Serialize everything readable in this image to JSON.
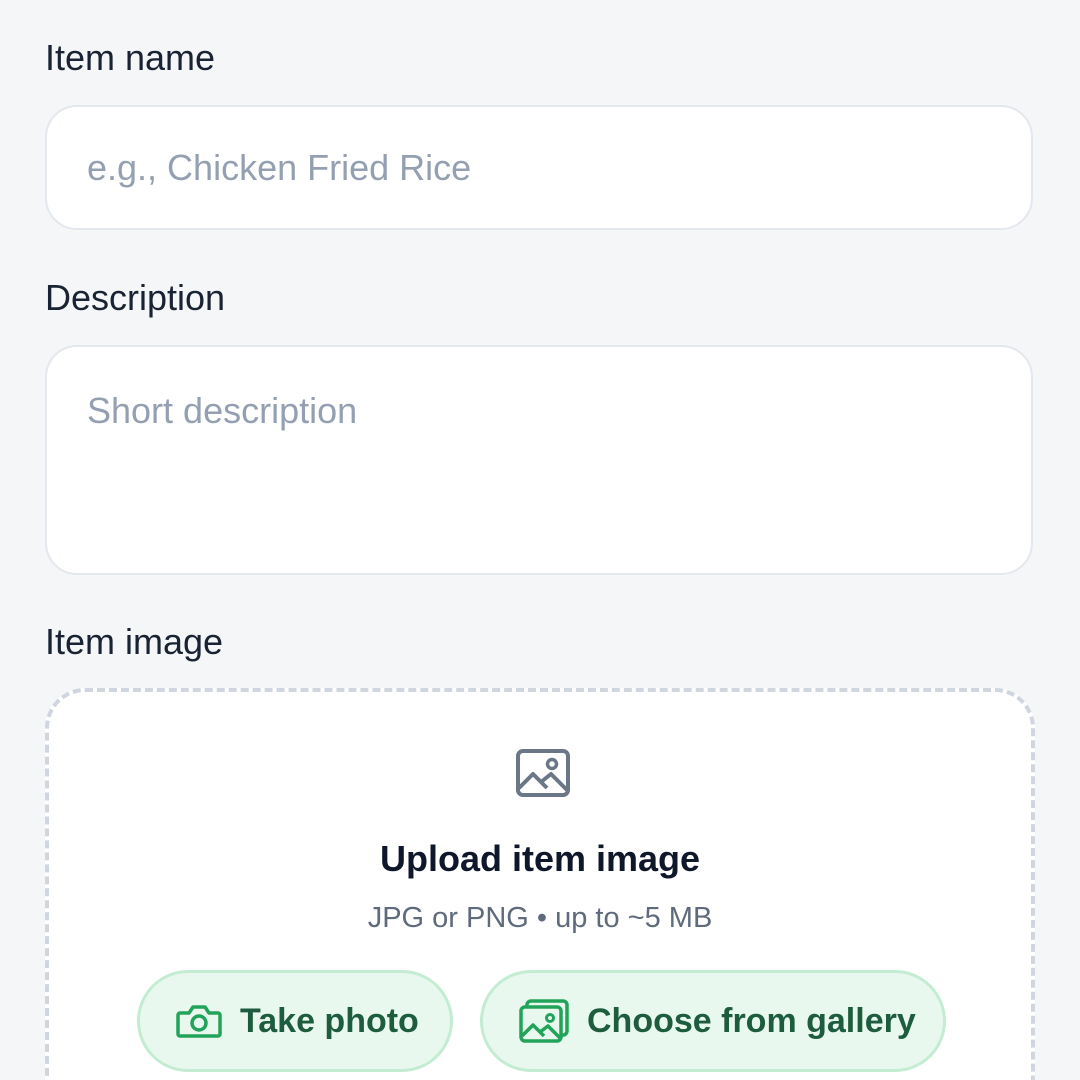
{
  "form": {
    "item_name": {
      "label": "Item name",
      "placeholder": "e.g., Chicken Fried Rice",
      "value": ""
    },
    "description": {
      "label": "Description",
      "placeholder": "Short description",
      "value": ""
    },
    "item_image": {
      "label": "Item image",
      "upload_icon": "image-icon",
      "title": "Upload item image",
      "hint": "JPG or PNG • up to ~5 MB",
      "buttons": {
        "take_photo": {
          "label": "Take photo",
          "icon": "camera-icon"
        },
        "gallery": {
          "label": "Choose from gallery",
          "icon": "gallery-icon"
        }
      }
    }
  },
  "colors": {
    "background": "#f4f6f8",
    "accent_green": "#1d5d3d",
    "icon_green": "#22a35a",
    "button_fill": "#e8f8ee",
    "placeholder": "#94a0b2"
  }
}
